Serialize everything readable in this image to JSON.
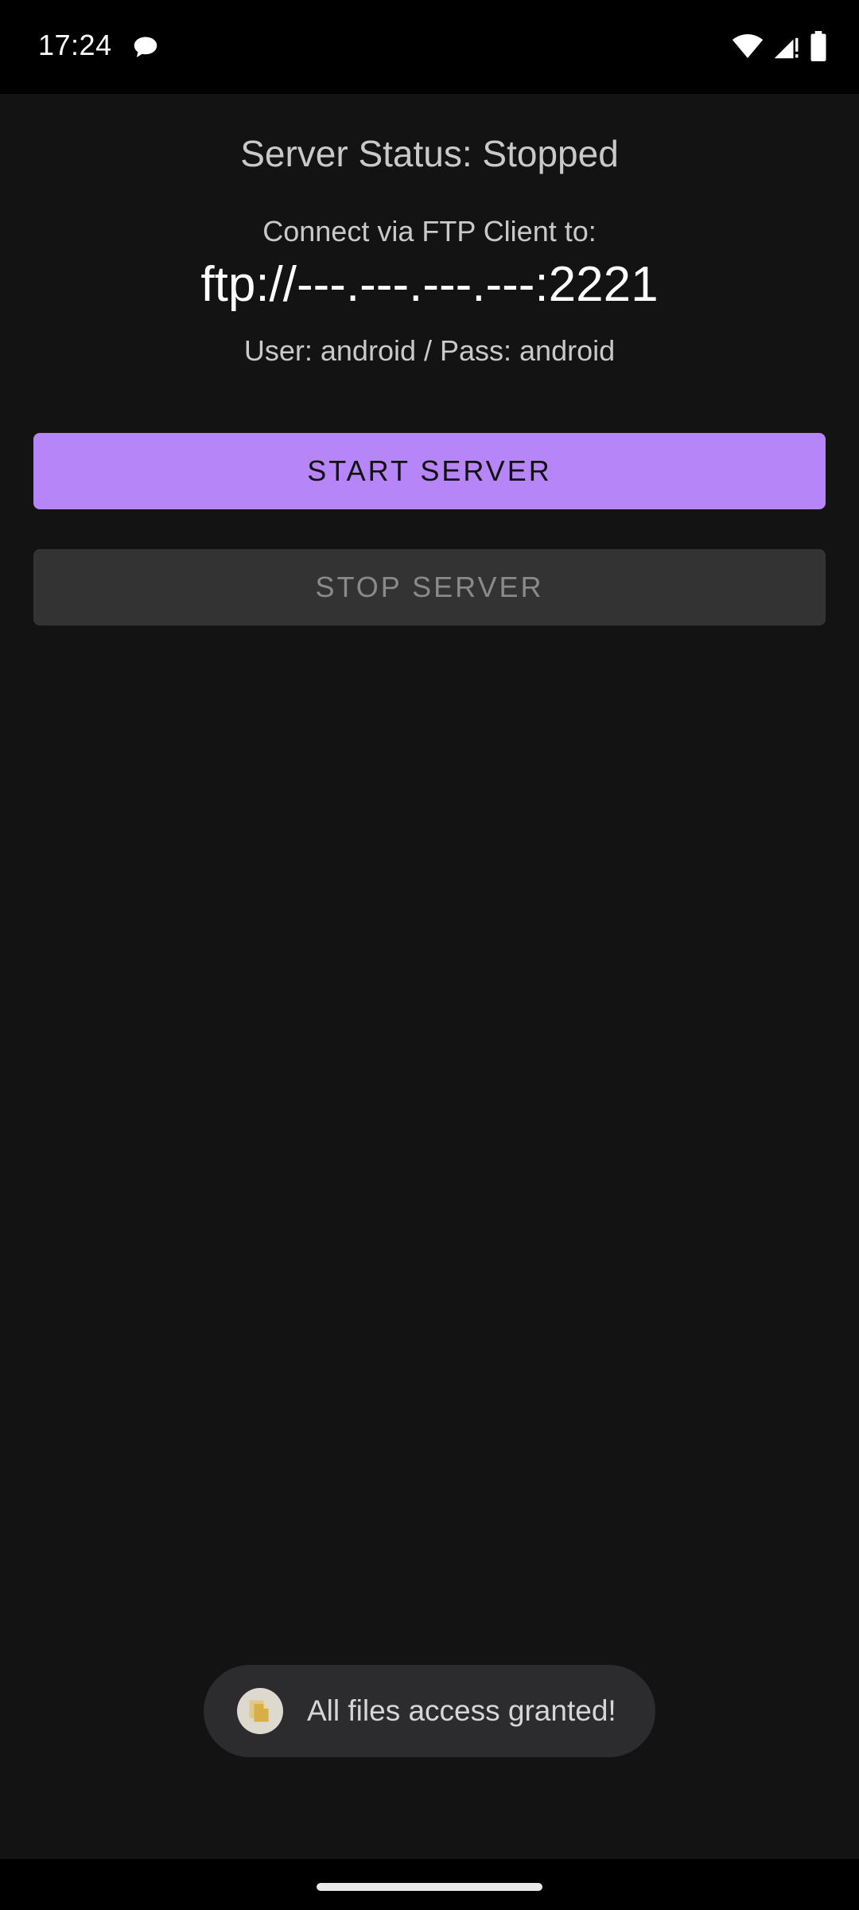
{
  "status_bar": {
    "time": "17:24",
    "icons": [
      "chat-notification-icon",
      "wifi-icon",
      "cellular-signal-icon",
      "battery-icon"
    ]
  },
  "main": {
    "server_status": "Server Status: Stopped",
    "connect_label": "Connect via FTP Client to:",
    "ftp_url": "ftp://---.---.---.---:2221",
    "credentials": "User: android / Pass: android",
    "start_button": "START SERVER",
    "stop_button": "STOP SERVER"
  },
  "toast": {
    "icon": "files-app-icon",
    "message": "All files access granted!"
  },
  "colors": {
    "background": "#131313",
    "accent": "#b685f7",
    "disabled_button": "#333333",
    "toast_bg": "#2c2c2e"
  }
}
